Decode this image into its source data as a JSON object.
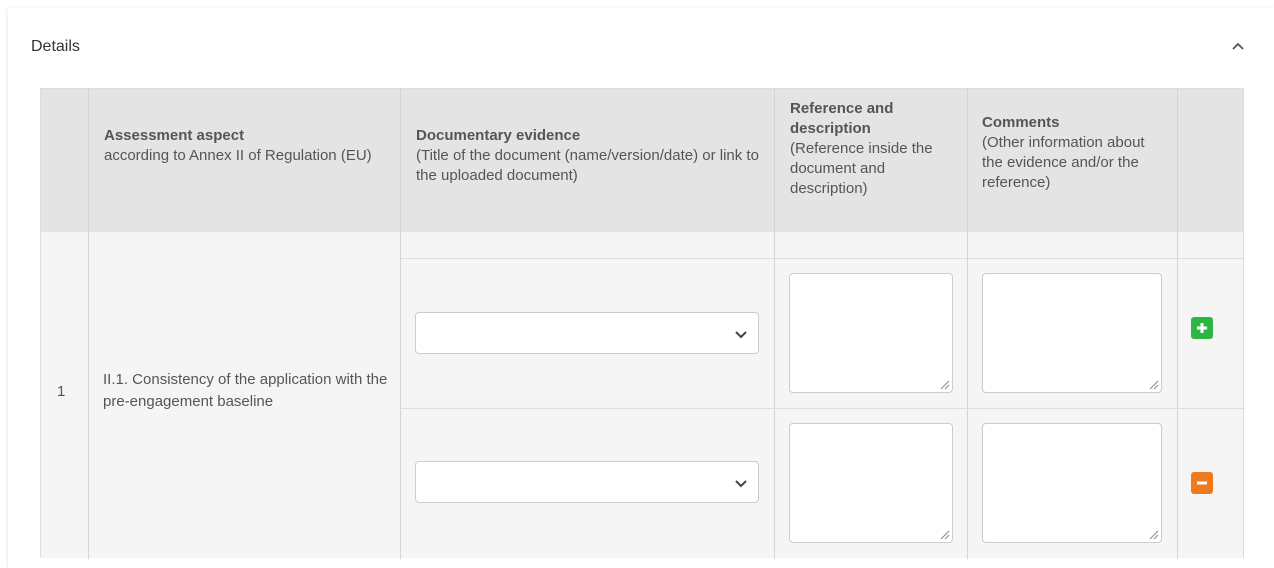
{
  "panel": {
    "title": "Details"
  },
  "table": {
    "headers": {
      "aspect": {
        "title": "Assessment aspect",
        "sub": "according to Annex II of Regulation (EU)"
      },
      "evidence": {
        "title": "Documentary evidence",
        "sub": "(Title of the document (name/version/date) or link to the uploaded document)"
      },
      "reference": {
        "title": "Reference and description",
        "sub": "(Reference inside the document and description)"
      },
      "comments": {
        "title": "Comments",
        "sub": "(Other information about the evidence and/or the reference)"
      }
    },
    "rows": [
      {
        "number": "1",
        "aspect_text": "II.1. Consistency of the application with the pre-engagement baseline",
        "entries": [
          {
            "evidence_value": "",
            "reference_value": "",
            "comments_value": "",
            "action": "add"
          },
          {
            "evidence_value": "",
            "reference_value": "",
            "comments_value": "",
            "action": "remove"
          }
        ]
      }
    ]
  },
  "icons": {
    "collapse": "chevron-up-icon",
    "add": "plus-icon",
    "remove": "minus-icon",
    "select": "chevron-down-icon"
  },
  "colors": {
    "add_button": "#2db742",
    "remove_button": "#f0791c",
    "header_bg": "#e4e4e4",
    "body_bg": "#f5f5f5"
  }
}
